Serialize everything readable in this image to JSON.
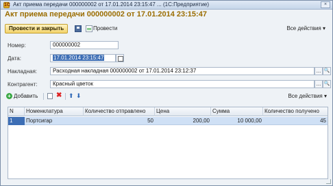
{
  "window": {
    "title": "Акт приема передачи 000000002 от 17.01.2014 23:15:47 ...",
    "app": "(1С:Предприятие)",
    "close_glyph": "×",
    "app_icon_glyph": "1С"
  },
  "header": {
    "title": "Акт приема передачи 000000002 от 17.01.2014 23:15:47"
  },
  "toolbar": {
    "post_and_close": "Провести и закрыть",
    "post": "Провести",
    "all_actions": "Все действия ▾"
  },
  "form": {
    "number_label": "Номер:",
    "number_value": "000000002",
    "date_label": "Дата:",
    "date_value": "17.01.2014 23:15:47",
    "invoice_label": "Накладная:",
    "invoice_value": "Расходная накладная 000000002 от 17.01.2014 23:12:37",
    "counterparty_label": "Контрагент:",
    "counterparty_value": "Красный цветок",
    "pick_glyph": "...",
    "search_glyph": "🔍"
  },
  "table_toolbar": {
    "add": "Добавить",
    "delete_glyph": "✖",
    "up_glyph": "⬆",
    "down_glyph": "⬇",
    "all_actions": "Все действия ▾"
  },
  "table": {
    "columns": [
      "N",
      "Номенклатура",
      "Количество отправлено",
      "Цена",
      "Сумма",
      "Количество получено"
    ],
    "rows": [
      {
        "n": "1",
        "item": "Портсигар",
        "qty_sent": "50",
        "price": "200,00",
        "sum": "10 000,00",
        "qty_received": "45"
      }
    ]
  }
}
